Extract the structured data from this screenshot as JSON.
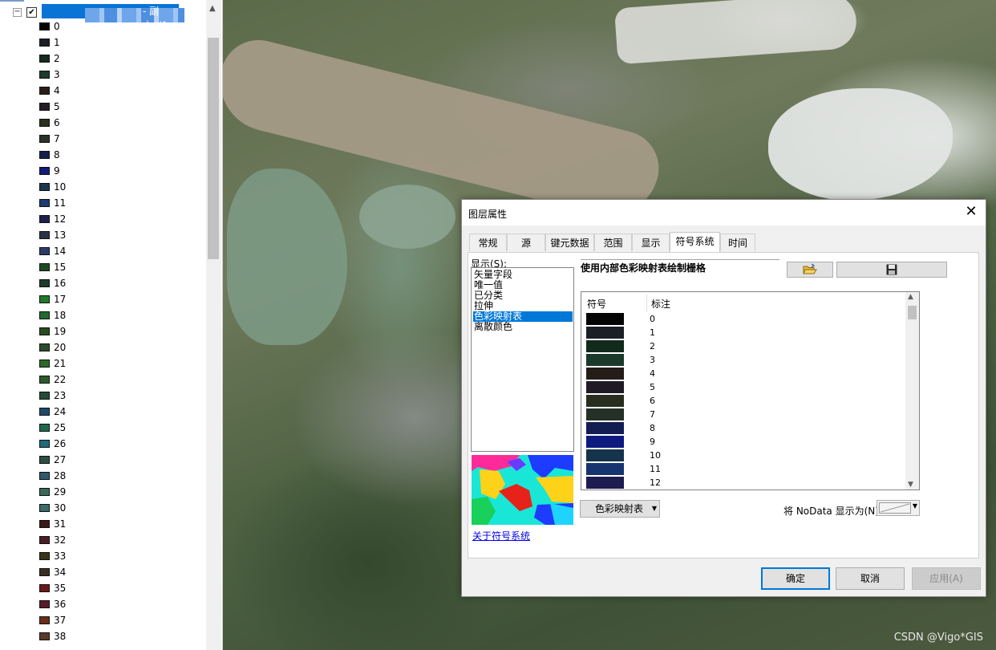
{
  "toc": {
    "layer": {
      "checked": true,
      "name_suffix": "- 副本.tif"
    },
    "legend": [
      {
        "label": "0",
        "color": "#050505"
      },
      {
        "label": "1",
        "color": "#1c1f26"
      },
      {
        "label": "2",
        "color": "#162a1e"
      },
      {
        "label": "3",
        "color": "#1e3a2a"
      },
      {
        "label": "4",
        "color": "#2a1f17"
      },
      {
        "label": "5",
        "color": "#231d24"
      },
      {
        "label": "6",
        "color": "#2a2f1e"
      },
      {
        "label": "7",
        "color": "#283325"
      },
      {
        "label": "8",
        "color": "#151e4e"
      },
      {
        "label": "9",
        "color": "#121a7a"
      },
      {
        "label": "10",
        "color": "#18384d"
      },
      {
        "label": "11",
        "color": "#1a3a70"
      },
      {
        "label": "12",
        "color": "#1f1f4f"
      },
      {
        "label": "13",
        "color": "#2a3448"
      },
      {
        "label": "14",
        "color": "#2e3a6a"
      },
      {
        "label": "15",
        "color": "#1c4a25"
      },
      {
        "label": "16",
        "color": "#1d3d2a"
      },
      {
        "label": "17",
        "color": "#1e7a2a"
      },
      {
        "label": "18",
        "color": "#1f6a2f"
      },
      {
        "label": "19",
        "color": "#2a4a20"
      },
      {
        "label": "20",
        "color": "#2e4a2e"
      },
      {
        "label": "21",
        "color": "#2a6a2a"
      },
      {
        "label": "22",
        "color": "#2e5a2e"
      },
      {
        "label": "23",
        "color": "#254a3a"
      },
      {
        "label": "24",
        "color": "#1e4a6a"
      },
      {
        "label": "25",
        "color": "#1e6a4a"
      },
      {
        "label": "26",
        "color": "#1e6a7a"
      },
      {
        "label": "27",
        "color": "#2e4e45"
      },
      {
        "label": "28",
        "color": "#2e5a6a"
      },
      {
        "label": "29",
        "color": "#3a6a5a"
      },
      {
        "label": "30",
        "color": "#3a6a6a"
      },
      {
        "label": "31",
        "color": "#3a1a1a"
      },
      {
        "label": "32",
        "color": "#4a1e24"
      },
      {
        "label": "33",
        "color": "#3a3418"
      },
      {
        "label": "34",
        "color": "#3a2e22"
      },
      {
        "label": "35",
        "color": "#6a1a1a"
      },
      {
        "label": "36",
        "color": "#5a1a28"
      },
      {
        "label": "37",
        "color": "#6a2e1a"
      },
      {
        "label": "38",
        "color": "#5a3a2a"
      }
    ]
  },
  "map": {
    "watermark": "CSDN @Vigo*GIS"
  },
  "dialog": {
    "title": "图层属性",
    "tabs": [
      "常规",
      "源",
      "键元数据",
      "范围",
      "显示",
      "符号系统",
      "时间"
    ],
    "active_tab": "符号系统",
    "show_label": "显示(S):",
    "show_items": [
      "矢量字段",
      "唯一值",
      "已分类",
      "拉伸",
      "色彩映射表",
      "离散颜色"
    ],
    "selected_show_item": "色彩映射表",
    "heading": "使用内部色彩映射表绘制栅格",
    "table": {
      "col_symbol": "符号",
      "col_label": "标注",
      "rows": [
        {
          "label": "0",
          "color": "#050505"
        },
        {
          "label": "1",
          "color": "#1c1f26"
        },
        {
          "label": "2",
          "color": "#112a1c"
        },
        {
          "label": "3",
          "color": "#1a3a2a"
        },
        {
          "label": "4",
          "color": "#241c17"
        },
        {
          "label": "5",
          "color": "#1f1a24"
        },
        {
          "label": "6",
          "color": "#272e1e"
        },
        {
          "label": "7",
          "color": "#253126"
        },
        {
          "label": "8",
          "color": "#121e52"
        },
        {
          "label": "9",
          "color": "#0f1a80"
        },
        {
          "label": "10",
          "color": "#15334a"
        },
        {
          "label": "11",
          "color": "#163570"
        },
        {
          "label": "12",
          "color": "#1c1c50"
        }
      ]
    },
    "colormap_button": "色彩映射表",
    "nodata_label": "将 NoData 显示为(N)",
    "about_link": "关于符号系统",
    "ok": "确定",
    "cancel": "取消",
    "apply": "应用(A)"
  }
}
